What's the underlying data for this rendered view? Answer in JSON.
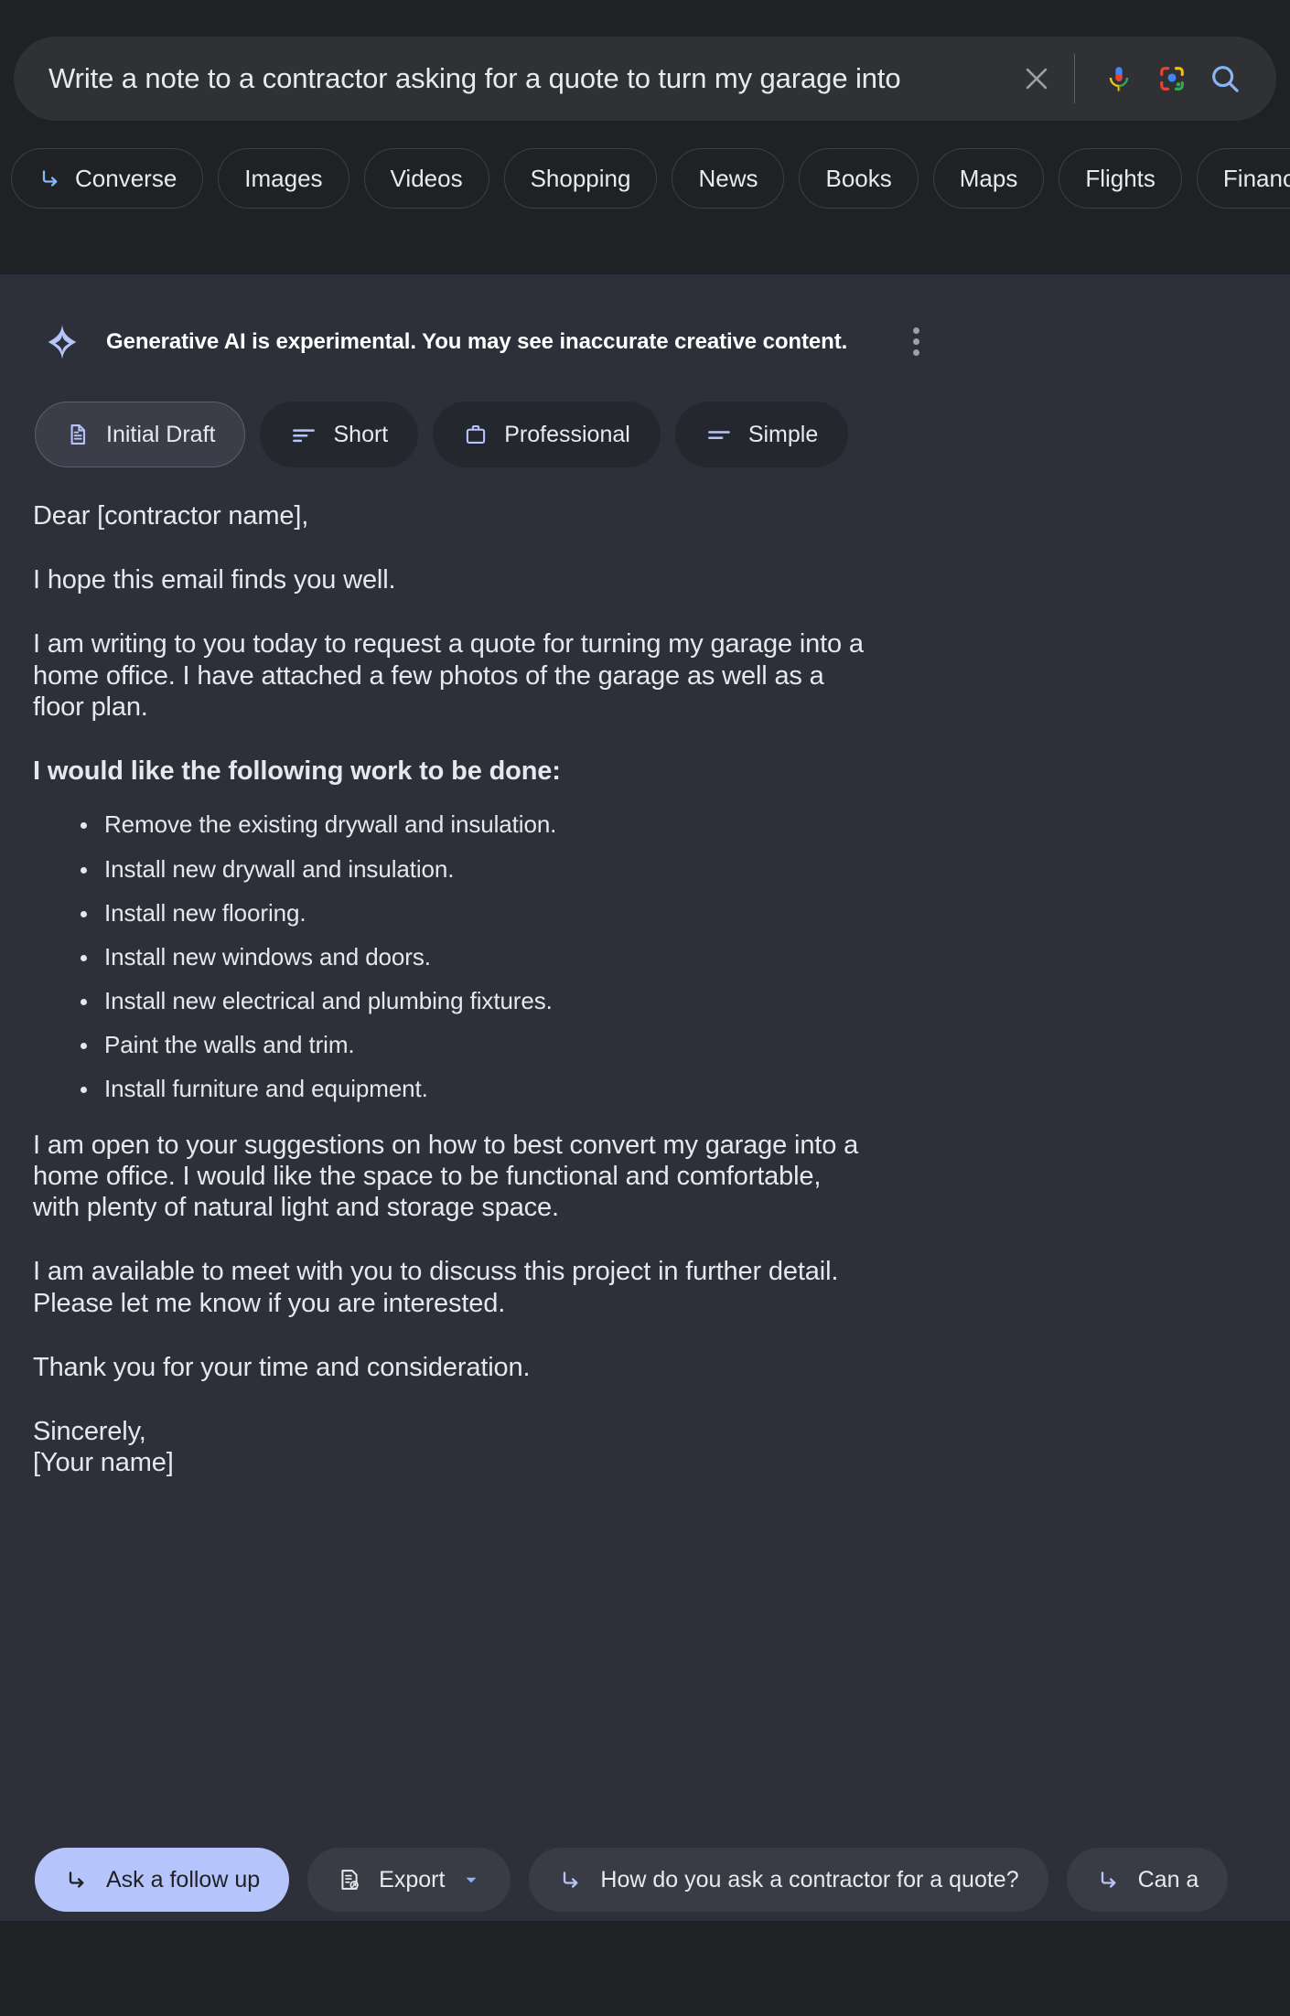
{
  "search": {
    "query": "Write a note to a contractor asking for a quote to turn my garage into",
    "clear_icon": "close-icon",
    "voice_icon": "microphone-icon",
    "lens_icon": "google-lens-icon",
    "submit_icon": "search-icon"
  },
  "tabs": [
    {
      "label": "Converse",
      "icon": "converse-arrow-icon",
      "has_icon": true
    },
    {
      "label": "Images",
      "icon": "",
      "has_icon": false
    },
    {
      "label": "Videos",
      "icon": "",
      "has_icon": false
    },
    {
      "label": "Shopping",
      "icon": "",
      "has_icon": false
    },
    {
      "label": "News",
      "icon": "",
      "has_icon": false
    },
    {
      "label": "Books",
      "icon": "",
      "has_icon": false
    },
    {
      "label": "Maps",
      "icon": "",
      "has_icon": false
    },
    {
      "label": "Flights",
      "icon": "",
      "has_icon": false
    },
    {
      "label": "Finance",
      "icon": "",
      "has_icon": false
    }
  ],
  "ai_notice": {
    "text": "Generative AI is experimental. You may see inaccurate creative content.",
    "sparkle_icon": "sparkle-icon",
    "menu_icon": "more-options-icon"
  },
  "style_chips": [
    {
      "label": "Initial Draft",
      "icon": "document-icon",
      "selected": true
    },
    {
      "label": "Short",
      "icon": "short-lines-icon",
      "selected": false
    },
    {
      "label": "Professional",
      "icon": "briefcase-icon",
      "selected": false
    },
    {
      "label": "Simple",
      "icon": "simple-lines-icon",
      "selected": false
    }
  ],
  "draft": {
    "greeting": "Dear [contractor name],",
    "para1": "I hope this email finds you well.",
    "para2": "I am writing to you today to request a quote for turning my garage into a home office. I have attached a few photos of the garage as well as a floor plan.",
    "list_heading": "I would like the following work to be done:",
    "list_items": [
      "Remove the existing drywall and insulation.",
      "Install new drywall and insulation.",
      "Install new flooring.",
      "Install new windows and doors.",
      "Install new electrical and plumbing fixtures.",
      "Paint the walls and trim.",
      "Install furniture and equipment."
    ],
    "para3": "I am open to your suggestions on how to best convert my garage into a home office. I would like the space to be functional and comfortable, with plenty of natural light and storage space.",
    "para4": "I am available to meet with you to discuss this project in further detail. Please let me know if you are interested.",
    "para5": "Thank you for your time and consideration.",
    "signature": "Sincerely,\n[Your name]"
  },
  "actions": [
    {
      "label": "Ask a follow up",
      "icon": "followup-arrow-icon",
      "primary": true,
      "dropdown": false
    },
    {
      "label": "Export",
      "icon": "export-doc-icon",
      "primary": false,
      "dropdown": true
    },
    {
      "label": "How do you ask a contractor for a quote?",
      "icon": "followup-arrow-icon",
      "primary": false,
      "dropdown": false
    },
    {
      "label": "Can a",
      "icon": "followup-arrow-icon",
      "primary": false,
      "dropdown": false
    }
  ],
  "colors": {
    "page_bg": "#1f2124",
    "panel_bg": "#2d2f39",
    "search_bg": "#303134",
    "accent_periwinkle": "#b5c4fb",
    "text_primary": "#e8eaed"
  }
}
